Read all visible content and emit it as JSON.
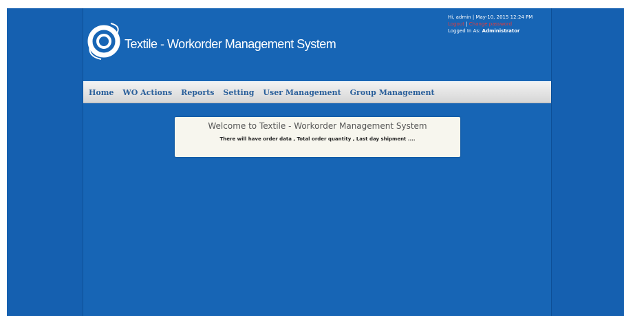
{
  "header": {
    "app_title": "Textile - Workorder Management System",
    "logo_icon": "swirl-logo-icon"
  },
  "user_panel": {
    "greeting": "Hi, admin | May-10, 2015 12:24 PM",
    "logout_label": "Logout",
    "link_separator": " | ",
    "change_password_label": "Change password",
    "logged_in_prefix": "Logged In As: ",
    "logged_in_role": "Administrator"
  },
  "nav": {
    "items": [
      {
        "label": "Home"
      },
      {
        "label": "WO Actions"
      },
      {
        "label": "Reports"
      },
      {
        "label": "Setting"
      },
      {
        "label": "User Management"
      },
      {
        "label": "Group Management"
      }
    ]
  },
  "main": {
    "welcome_title": "Welcome to Textile - Workorder Management System",
    "welcome_body": "There will have order data , Total order quantity , Last day shipment ...."
  },
  "colors": {
    "background": "#1560b0",
    "navbar": "#e4e4e4",
    "nav_text": "#2a5f9a",
    "link_red": "#e53b3b",
    "welcome_box": "#f7f6ee"
  }
}
